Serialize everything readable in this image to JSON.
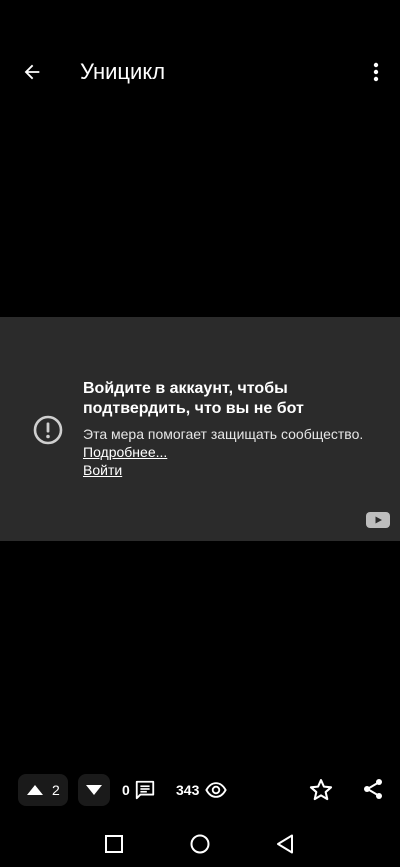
{
  "appbar": {
    "title": "Уницикл",
    "back_icon": "arrow-left-icon",
    "more_icon": "more-vertical-icon"
  },
  "video": {
    "message_title": "Войдите в аккаунт, чтобы подтвердить, что вы не бот",
    "message_desc": "Эта мера помогает защищать сообщество.",
    "more_link": "Подробнее...",
    "login_link": "Войти",
    "alert_icon": "alert-circle-icon",
    "logo_icon": "youtube-logo-icon"
  },
  "actions": {
    "upvotes": "2",
    "comments": "0",
    "views": "343"
  },
  "colors": {
    "background": "#000000",
    "panel": "#2b2b2b",
    "pill": "#1a1a1a"
  }
}
